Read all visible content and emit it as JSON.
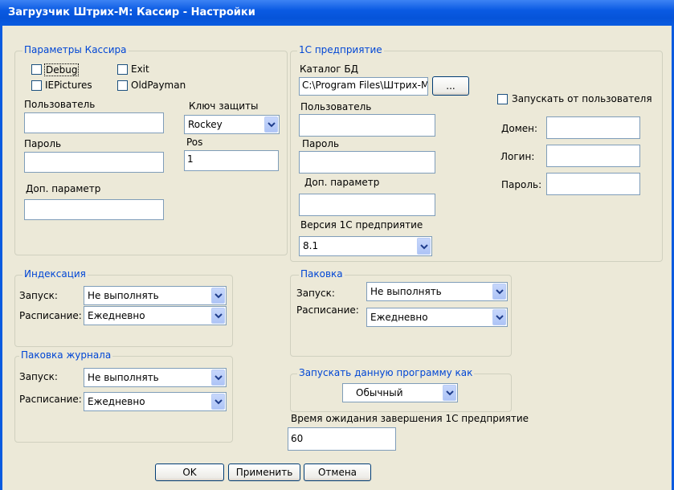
{
  "window": {
    "title": "Загрузчик Штрих-М: Кассир - Настройки"
  },
  "cashier": {
    "legend": "Параметры Кассира",
    "flags": {
      "debug": "Debug",
      "exit": "Exit",
      "iepictures": "IEPictures",
      "oldpayman": "OldPayman"
    },
    "user_label": "Пользователь",
    "user_value": "",
    "password_label": "Пароль",
    "password_value": "",
    "extra_label": "Доп. параметр",
    "extra_value": "",
    "key_label": "Ключ защиты",
    "key_value": "Rockey",
    "pos_label": "Pos",
    "pos_value": "1"
  },
  "enterprise": {
    "legend": "1С предприятие",
    "catalog_label": "Каталог БД",
    "catalog_value": "C:\\Program Files\\Штрих-М",
    "browse_label": "...",
    "user_label": "Пользователь",
    "user_value": "",
    "password_label": "Пароль",
    "password_value": "",
    "extra_label": "Доп. параметр",
    "extra_value": "",
    "version_label": "Версия 1С предприятие",
    "version_value": "8.1",
    "run_as_user_label": "Запускать от пользователя",
    "domain_label": "Домен:",
    "domain_value": "",
    "login_label": "Логин:",
    "login_value": "",
    "pass_label": "Пароль:",
    "pass_value": ""
  },
  "indexing": {
    "legend": "Индексация",
    "launch_label": "Запуск:",
    "launch_value": "Не выполнять",
    "schedule_label": "Расписание:",
    "schedule_value": "Ежедневно"
  },
  "packing": {
    "legend": "Паковка",
    "launch_label": "Запуск:",
    "launch_value": "Не выполнять",
    "schedule_label": "Расписание:",
    "schedule_value": "Ежедневно"
  },
  "journal_packing": {
    "legend": "Паковка журнала",
    "launch_label": "Запуск:",
    "launch_value": "Не выполнять",
    "schedule_label": "Расписание:",
    "schedule_value": "Ежедневно"
  },
  "run_mode": {
    "legend": "Запускать данную программу как",
    "value": "Обычный"
  },
  "wait": {
    "label": "Время ожидания завершения 1С предприятие",
    "value": "60"
  },
  "buttons": {
    "ok": "OK",
    "apply": "Применить",
    "cancel": "Отмена"
  },
  "colors": {
    "title_bar": "#0a5be0",
    "legend_text": "#0046d5",
    "dialog_bg": "#ece9d8"
  }
}
